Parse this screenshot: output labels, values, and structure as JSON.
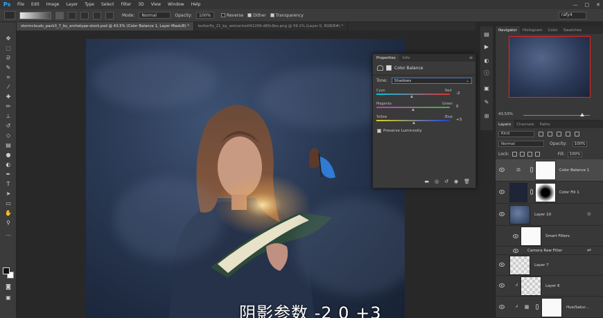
{
  "app": {
    "logo": "Ps"
  },
  "menubar": {
    "items": [
      "File",
      "Edit",
      "Image",
      "Layer",
      "Type",
      "Select",
      "Filter",
      "3D",
      "View",
      "Window",
      "Help"
    ],
    "window_controls": {
      "minimize": "—",
      "maximize": "□",
      "close": "✕"
    }
  },
  "options": {
    "mode_label": "Mode:",
    "mode_value": "Normal",
    "opacity_label": "Opacity:",
    "opacity_value": "100%",
    "reverse_label": "Reverse",
    "dither_label": "Dither",
    "transparency_label": "Transparency",
    "workspace_value": "rafy4"
  },
  "tabs": [
    {
      "label": "stormclouds_pack3_7_by_archetype-stock.psd @ 43.5% (Color Balance 1, Layer Mask/8) *",
      "active": true
    },
    {
      "label": "butterfly_21_by_wolverine041269-d65c8os.png @ 59.1% (Layer 0, RGB/8#) *",
      "active": false
    }
  ],
  "properties": {
    "tabs": [
      "Properties",
      "Info"
    ],
    "title": "Color Balance",
    "tone_label": "Tone:",
    "tone_value": "Shadows",
    "sliders": [
      {
        "left": "Cyan",
        "right": "Red",
        "value": "-2",
        "level": -2
      },
      {
        "left": "Magenta",
        "right": "Green",
        "value": "0",
        "level": 0
      },
      {
        "left": "Yellow",
        "right": "Blue",
        "value": "+3",
        "level": 3
      }
    ],
    "preserve_label": "Preserve Luminosity"
  },
  "navigator": {
    "tabs": [
      "Navigator",
      "Histogram",
      "Color",
      "Swatches"
    ],
    "zoom": "43.53%"
  },
  "layers": {
    "tabs": [
      "Layers",
      "Channels",
      "Paths"
    ],
    "kind_value": "Kind",
    "blend_value": "Normal",
    "opacity_label": "Opacity:",
    "opacity_value": "100%",
    "lock_label": "Lock:",
    "fill_label": "Fill:",
    "fill_value": "100%",
    "items": [
      {
        "name": "Color Balance 1"
      },
      {
        "name": "Color Fill 1"
      },
      {
        "name": "Layer 10"
      },
      {
        "name": "Smart Filters"
      },
      {
        "name": "Camera Raw Filter"
      },
      {
        "name": "Layer 7"
      },
      {
        "name": "Layer 6"
      },
      {
        "name": "Hue/Satur..."
      }
    ]
  },
  "subtitle": "阴影参数 -2 0 +3"
}
